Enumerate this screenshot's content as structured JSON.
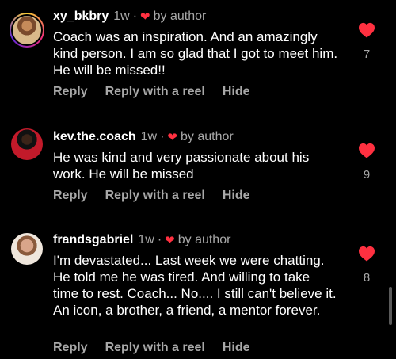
{
  "colors": {
    "background": "#000000",
    "heart": "#ff3040",
    "muted": "#a8a8a8"
  },
  "comments": [
    {
      "username": "xy_bkbry",
      "time": "1w",
      "separator": "·",
      "author_label": "by author",
      "text": "Coach was an inspiration. And an amazingly kind person. I am so glad that I got to meet him. He will be missed!!",
      "like_count": "7",
      "actions": {
        "reply": "Reply",
        "reply_reel": "Reply with a reel",
        "hide": "Hide"
      }
    },
    {
      "username": "kev.the.coach",
      "time": "1w",
      "separator": "·",
      "author_label": "by author",
      "text": "He was kind and very passionate about his work. He will be missed",
      "like_count": "9",
      "actions": {
        "reply": "Reply",
        "reply_reel": "Reply with a reel",
        "hide": "Hide"
      }
    },
    {
      "username": "frandsgabriel",
      "time": "1w",
      "separator": "·",
      "author_label": "by author",
      "text": "I'm devastated... Last week we were chatting. He told me he was tired. And willing to take time to rest. Coach... No.... I still can't believe it. An icon, a brother, a friend, a mentor forever.",
      "like_count": "8",
      "actions": {
        "reply": "Reply",
        "reply_reel": "Reply with a reel",
        "hide": "Hide"
      }
    }
  ]
}
